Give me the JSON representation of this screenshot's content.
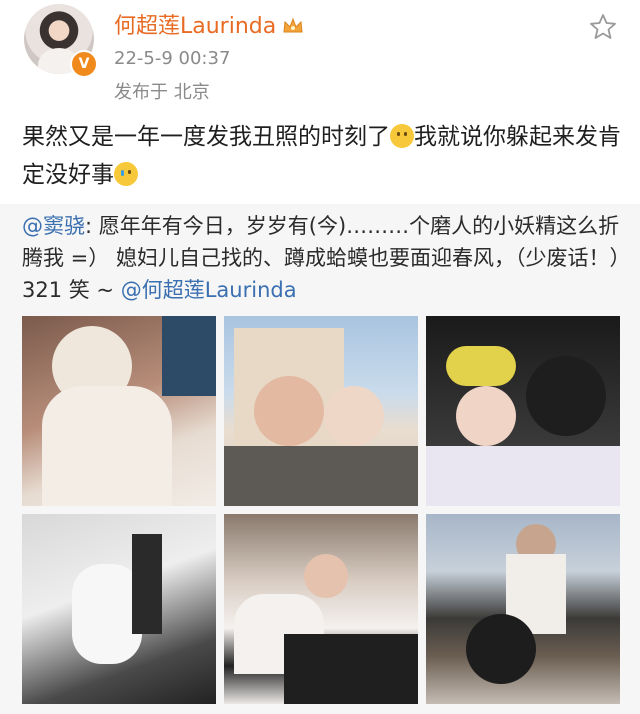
{
  "post": {
    "author": "何超莲Laurinda",
    "timestamp": "22-5-9 00:37",
    "location": "发布于 北京",
    "text_part1": "果然又是一年一度发我丑照的时刻了",
    "text_part2": "我就说你躲起来发肯定没好事",
    "verified_badge": "V",
    "accent_color": "#e86b24"
  },
  "repost": {
    "mention_author": "@窦骁",
    "text": ": 愿年年有今日，岁岁有(今)………个磨人的小妖精这么折腾我 =） 媳妇儿自己找的、蹲成蛤蟆也要面迎春风，（少废话！）321 笑 ~ ",
    "mention_tail": "@何超莲Laurinda",
    "mention_color": "#3a6fb0"
  },
  "icons": {
    "crown": "crown-icon",
    "star": "star-icon",
    "emoji_smile": "smile-emoji-icon",
    "emoji_cry": "laugh-cry-emoji-icon"
  }
}
